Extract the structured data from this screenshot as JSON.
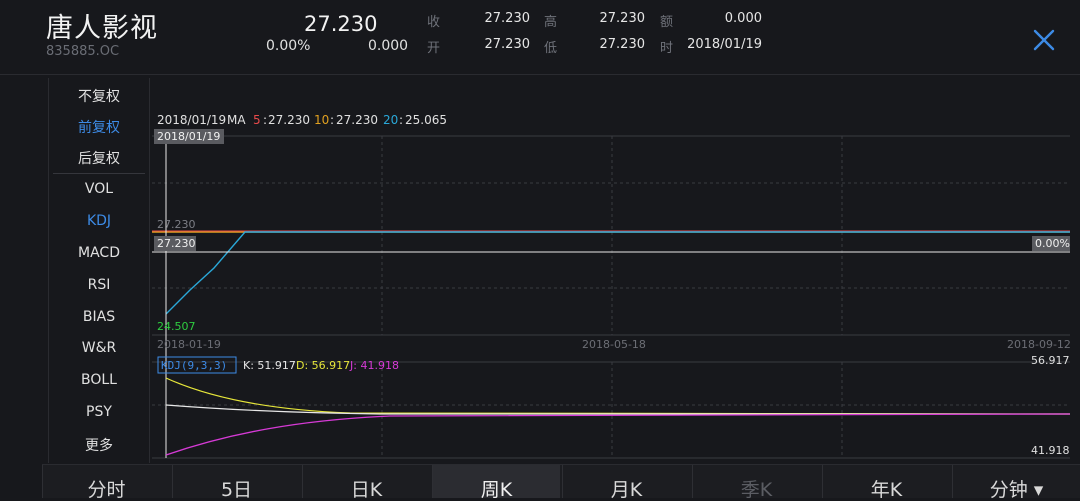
{
  "stock": {
    "name": "唐人影视",
    "code": "835885.OC",
    "price": "27.230",
    "change_pct": "0.00%",
    "change_abs": "0.000"
  },
  "quote": {
    "close_label": "收",
    "close_value": "27.230",
    "open_label": "开",
    "open_value": "27.230",
    "high_label": "高",
    "high_value": "27.230",
    "low_label": "低",
    "low_value": "27.230",
    "amount_label": "额",
    "amount_value": "0.000",
    "time_label": "时",
    "time_value": "2018/01/19"
  },
  "sidebar": {
    "items": [
      {
        "label": "不复权",
        "active": false
      },
      {
        "label": "前复权",
        "active": true
      },
      {
        "label": "后复权",
        "active": false
      },
      {
        "label": "VOL",
        "active": false
      },
      {
        "label": "KDJ",
        "active": true
      },
      {
        "label": "MACD",
        "active": false
      },
      {
        "label": "RSI",
        "active": false
      },
      {
        "label": "BIAS",
        "active": false
      },
      {
        "label": "W&R",
        "active": false
      },
      {
        "label": "BOLL",
        "active": false
      },
      {
        "label": "PSY",
        "active": false
      },
      {
        "label": "更多",
        "active": false
      }
    ]
  },
  "chart": {
    "ma_date": "2018/01/19",
    "ma_label": "MA",
    "ma5_key": "5",
    "ma5_value": "27.230",
    "ma10_key": "10",
    "ma10_value": "27.230",
    "ma20_key": "20",
    "ma20_value": "25.065",
    "cursor_date": "2018/01/19",
    "price_high_label": "27.230",
    "cursor_price": "27.230",
    "cursor_pct": "0.00%",
    "price_low_label": "24.507",
    "x_tick_1": "2018-01-19",
    "x_tick_2": "2018-05-18",
    "x_tick_3": "2018-09-12",
    "kdj_label": "KDJ(9,3,3)",
    "kdj_k": "K: 51.917",
    "kdj_d": "D: 56.917",
    "kdj_j": "J: 41.918",
    "kdj_max": "56.917",
    "kdj_min": "41.918",
    "colors": {
      "ma5": "#e84a4a",
      "ma10": "#e0a020",
      "ma20": "#2aa8d8",
      "k": "#e8e8e8",
      "d": "#e6e63a",
      "j": "#d63ad6",
      "low": "#2ecc40"
    }
  },
  "tabs": [
    {
      "label": "分时",
      "state": "normal"
    },
    {
      "label": "5日",
      "state": "normal"
    },
    {
      "label": "日K",
      "state": "normal"
    },
    {
      "label": "周K",
      "state": "active"
    },
    {
      "label": "月K",
      "state": "normal"
    },
    {
      "label": "季K",
      "state": "disabled"
    },
    {
      "label": "年K",
      "state": "normal"
    },
    {
      "label": "分钟 ▾",
      "state": "normal"
    }
  ]
}
